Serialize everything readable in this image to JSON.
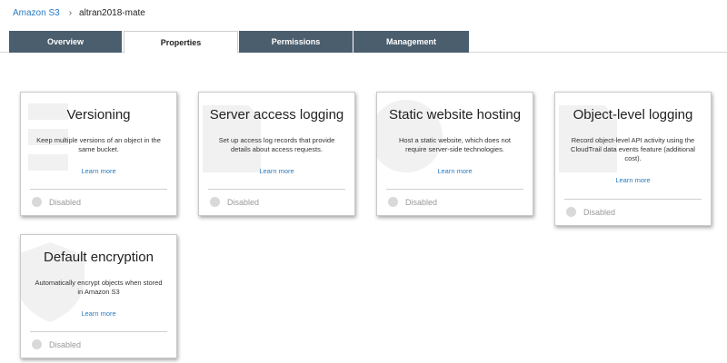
{
  "breadcrumb": {
    "root": "Amazon S3",
    "separator": "›",
    "current": "altran2018-mate"
  },
  "tabs": [
    {
      "label": "Overview",
      "active": false
    },
    {
      "label": "Properties",
      "active": true
    },
    {
      "label": "Permissions",
      "active": false
    },
    {
      "label": "Management",
      "active": false
    }
  ],
  "cards": [
    {
      "title": "Versioning",
      "description": "Keep multiple versions of an object in the same bucket.",
      "link": "Learn more",
      "status": "Disabled"
    },
    {
      "title": "Server access logging",
      "description": "Set up access log records that provide details about access requests.",
      "link": "Learn more",
      "status": "Disabled"
    },
    {
      "title": "Static website hosting",
      "description": "Host a static website, which does not require server-side technologies.",
      "link": "Learn more",
      "status": "Disabled"
    },
    {
      "title": "Object-level logging",
      "description": "Record object-level API activity using the CloudTrail data events feature (additional cost).",
      "link": "Learn more",
      "status": "Disabled"
    },
    {
      "title": "Default encryption",
      "description": "Automatically encrypt objects when stored in Amazon S3",
      "link": "Learn more",
      "status": "Disabled"
    }
  ],
  "colors": {
    "tab_inactive": "#4b5e6e",
    "link": "#2b7bbf",
    "status_dot": "#d9d9d9"
  }
}
